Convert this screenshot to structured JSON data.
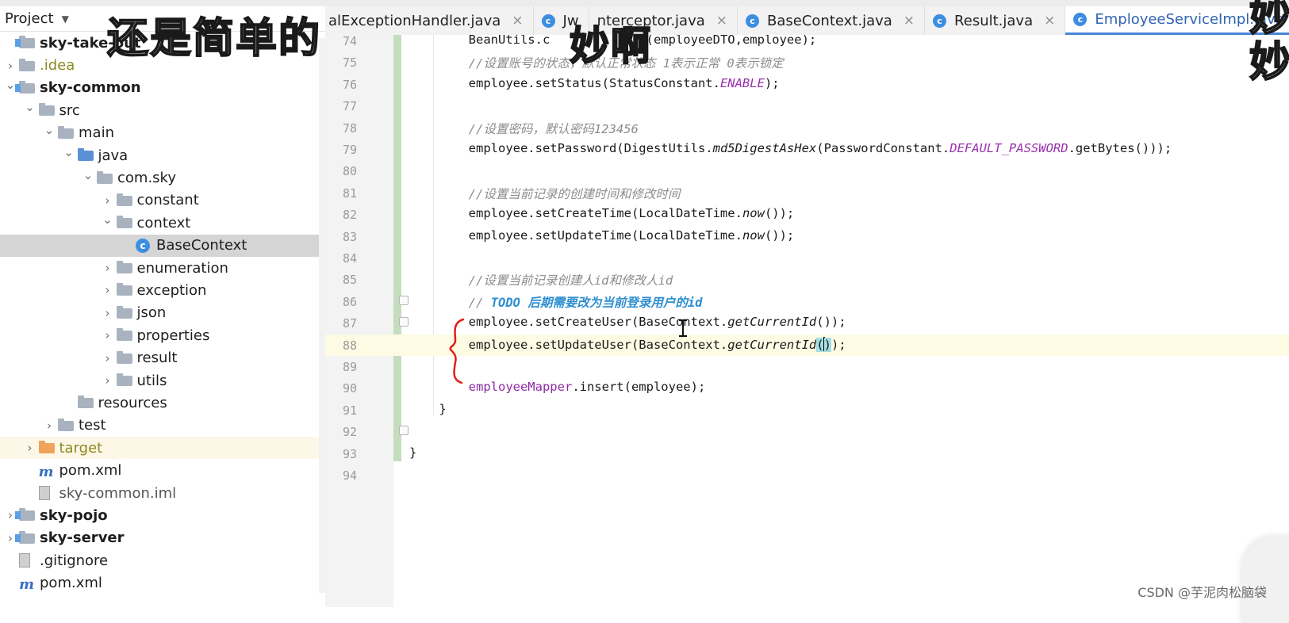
{
  "project_panel": {
    "title": "Project",
    "items": [
      {
        "label": "sky-take-out",
        "style": "bold"
      },
      {
        "label": ".idea",
        "style": "olive"
      },
      {
        "label": "sky-common",
        "style": "bold"
      },
      {
        "label": "src"
      },
      {
        "label": "main"
      },
      {
        "label": "java"
      },
      {
        "label": "com.sky"
      },
      {
        "label": "constant"
      },
      {
        "label": "context"
      },
      {
        "label": "BaseContext"
      },
      {
        "label": "enumeration"
      },
      {
        "label": "exception"
      },
      {
        "label": "json"
      },
      {
        "label": "properties"
      },
      {
        "label": "result"
      },
      {
        "label": "utils"
      },
      {
        "label": "resources"
      },
      {
        "label": "test"
      },
      {
        "label": "target",
        "style": "olive"
      },
      {
        "label": "pom.xml"
      },
      {
        "label": "sky-common.iml",
        "style": "grey"
      },
      {
        "label": "sky-pojo",
        "style": "bold"
      },
      {
        "label": "sky-server",
        "style": "bold"
      },
      {
        "label": ".gitignore"
      },
      {
        "label": "pom.xml"
      }
    ]
  },
  "tabs": [
    {
      "label": "alExceptionHandler.java"
    },
    {
      "label": "Jw"
    },
    {
      "label": "nterceptor.java"
    },
    {
      "label": "BaseContext.java"
    },
    {
      "label": "Result.java"
    },
    {
      "label": "EmployeeServiceImpl.java",
      "active": true
    }
  ],
  "editor": {
    "current_line": 88,
    "lines": [
      {
        "num": "74",
        "parts": [
          {
            "t": "        BeanUtils.c"
          },
          {
            "t": "             (employeeDTO,employee);"
          }
        ]
      },
      {
        "num": "75",
        "parts": [
          {
            "t": "        //设置账号的状态，默认正常状态 1表示正常 0表示锁定",
            "c": "cmt"
          }
        ]
      },
      {
        "num": "76",
        "parts": [
          {
            "t": "        employee.setStatus(StatusConstant."
          },
          {
            "t": "ENABLE",
            "c": "kw"
          },
          {
            "t": ");"
          }
        ]
      },
      {
        "num": "77",
        "parts": []
      },
      {
        "num": "78",
        "parts": [
          {
            "t": "        //设置密码，默认密码123456",
            "c": "cmt"
          }
        ]
      },
      {
        "num": "79",
        "parts": [
          {
            "t": "        employee.setPassword(DigestUtils."
          },
          {
            "t": "md5DigestAsHex",
            "c": "it"
          },
          {
            "t": "(PasswordConstant."
          },
          {
            "t": "DEFAULT_PASSWORD",
            "c": "kw"
          },
          {
            "t": ".getBytes()));"
          }
        ]
      },
      {
        "num": "80",
        "parts": []
      },
      {
        "num": "81",
        "parts": [
          {
            "t": "        //设置当前记录的创建时间和修改时间",
            "c": "cmt"
          }
        ]
      },
      {
        "num": "82",
        "parts": [
          {
            "t": "        employee.setCreateTime(LocalDateTime."
          },
          {
            "t": "now",
            "c": "it"
          },
          {
            "t": "());"
          }
        ]
      },
      {
        "num": "83",
        "parts": [
          {
            "t": "        employee.setUpdateTime(LocalDateTime."
          },
          {
            "t": "now",
            "c": "it"
          },
          {
            "t": "());"
          }
        ]
      },
      {
        "num": "84",
        "parts": []
      },
      {
        "num": "85",
        "parts": [
          {
            "t": "        //设置当前记录创建人id和修改人id",
            "c": "cmt"
          }
        ]
      },
      {
        "num": "86",
        "parts": [
          {
            "t": "        // ",
            "c": "cmt"
          },
          {
            "t": "TODO 后期需要改为当前登录用户的id",
            "c": "todo"
          }
        ]
      },
      {
        "num": "87",
        "parts": [
          {
            "t": "        employee.setCreateUser(BaseContext."
          },
          {
            "t": "getCurrentId",
            "c": "it"
          },
          {
            "t": "());"
          }
        ]
      },
      {
        "num": "88",
        "parts": [
          {
            "t": "        employee.setUpdateUser(BaseContext."
          },
          {
            "t": "getCurrentId",
            "c": "it"
          },
          {
            "t": "()",
            "c": "hl"
          },
          {
            "t": ");"
          }
        ]
      },
      {
        "num": "89",
        "parts": []
      },
      {
        "num": "90",
        "parts": [
          {
            "t": "        "
          },
          {
            "t": "employeeMapper",
            "c": "field"
          },
          {
            "t": ".insert(employee);"
          }
        ]
      },
      {
        "num": "91",
        "parts": [
          {
            "t": "    }"
          }
        ]
      },
      {
        "num": "92",
        "parts": []
      },
      {
        "num": "93",
        "parts": [
          {
            "t": "}"
          }
        ]
      },
      {
        "num": "94",
        "parts": []
      }
    ]
  },
  "overlays": {
    "caption_left": "还是简单的",
    "caption_mid": "妙啊",
    "caption_right": "妙妙",
    "watermark": "CSDN @芋泥肉松脑袋"
  },
  "colors": {
    "comment": "#8c8c8c",
    "todo": "#2f8fd0",
    "constant": "#9b2fae",
    "active_tab": "#2f63b0",
    "annotation_red": "#e0201a",
    "bracket_highlight": "#a4dde3"
  }
}
